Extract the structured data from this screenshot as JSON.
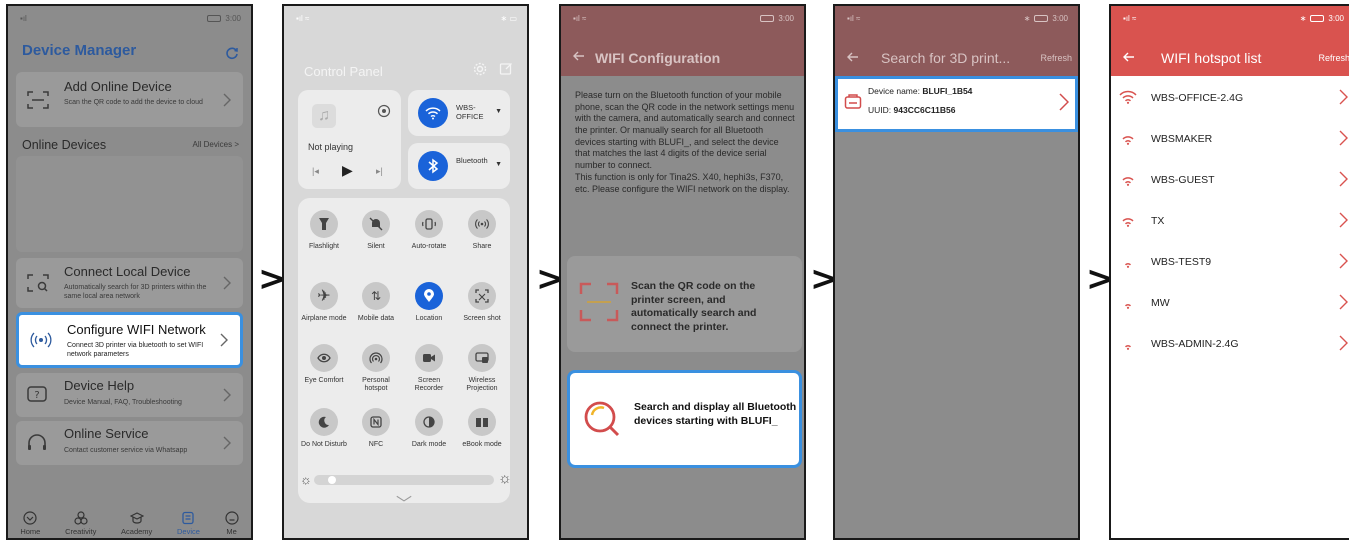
{
  "arrows": [
    ">",
    ">",
    ">",
    ">"
  ],
  "colors": {
    "accent_blue": "#2d5a9e",
    "highlight_border": "#3a90e0",
    "brand_red": "#d9534f",
    "control_blue": "#1a63d9"
  },
  "screen1": {
    "status_time": "3:00",
    "title": "Device Manager",
    "add_device": {
      "title": "Add Online Device",
      "subtitle": "Scan the QR code to add the device to cloud"
    },
    "online_devices_label": "Online Devices",
    "all_devices_link": "All Devices >",
    "connect_local": {
      "title": "Connect Local Device",
      "subtitle": "Automatically search for 3D printers within the same local area network"
    },
    "configure_wifi": {
      "title": "Configure WIFI Network",
      "subtitle": "Connect 3D printer via bluetooth to set WIFI network parameters"
    },
    "device_help": {
      "title": "Device Help",
      "subtitle": "Device Manual, FAQ, Troubleshooting"
    },
    "online_service": {
      "title": "Online Service",
      "subtitle": "Contact customer service via Whatsapp"
    },
    "tabs": [
      "Home",
      "Creativity",
      "Academy",
      "Device",
      "Me"
    ]
  },
  "screen2": {
    "title": "Control Panel",
    "media_status": "Not playing",
    "wifi_label": "WBS-OFFICE",
    "bluetooth_label": "Bluetooth",
    "toggles": [
      "Flashlight",
      "Silent",
      "Auto-rotate",
      "Share",
      "Airplane mode",
      "Mobile data",
      "Location",
      "Screen shot",
      "Eye Comfort",
      "Personal hotspot",
      "Screen Recorder",
      "Wireless Projection",
      "Do Not Disturb",
      "NFC",
      "Dark mode",
      "eBook mode"
    ],
    "brightness": 0.08
  },
  "screen3": {
    "status_time": "3:00",
    "title": "WIFI Configuration",
    "instructions": "Please turn on the Bluetooth function of your mobile phone, scan the QR code in the network settings menu with the camera, and automatically search and connect the printer. Or manually search for all Bluetooth devices starting with BLUFI_, and select the device that matches the last 4 digits of the device serial number to connect.\nThis function is only for Tina2S. X40, hephi3s, F370, etc. Please configure the WIFI network on the display.",
    "scan_option": "Scan the QR code on the printer screen, and automatically search and connect the printer.",
    "search_option": "Search and display all Bluetooth devices starting with BLUFI_"
  },
  "screen4": {
    "status_time": "3:00",
    "title": "Search for 3D print...",
    "refresh": "Refresh",
    "device_name_label": "Device name:",
    "device_name": "BLUFI_1B54",
    "uuid_label": "UUID:",
    "uuid": "943CC6C11B56"
  },
  "screen5": {
    "status_time": "3:00",
    "title": "WIFI hotspot list",
    "refresh": "Refresh",
    "networks": [
      "WBS-OFFICE-2.4G",
      "WBSMAKER",
      "WBS-GUEST",
      "TX",
      "WBS-TEST9",
      "MW",
      "WBS-ADMIN-2.4G"
    ]
  }
}
